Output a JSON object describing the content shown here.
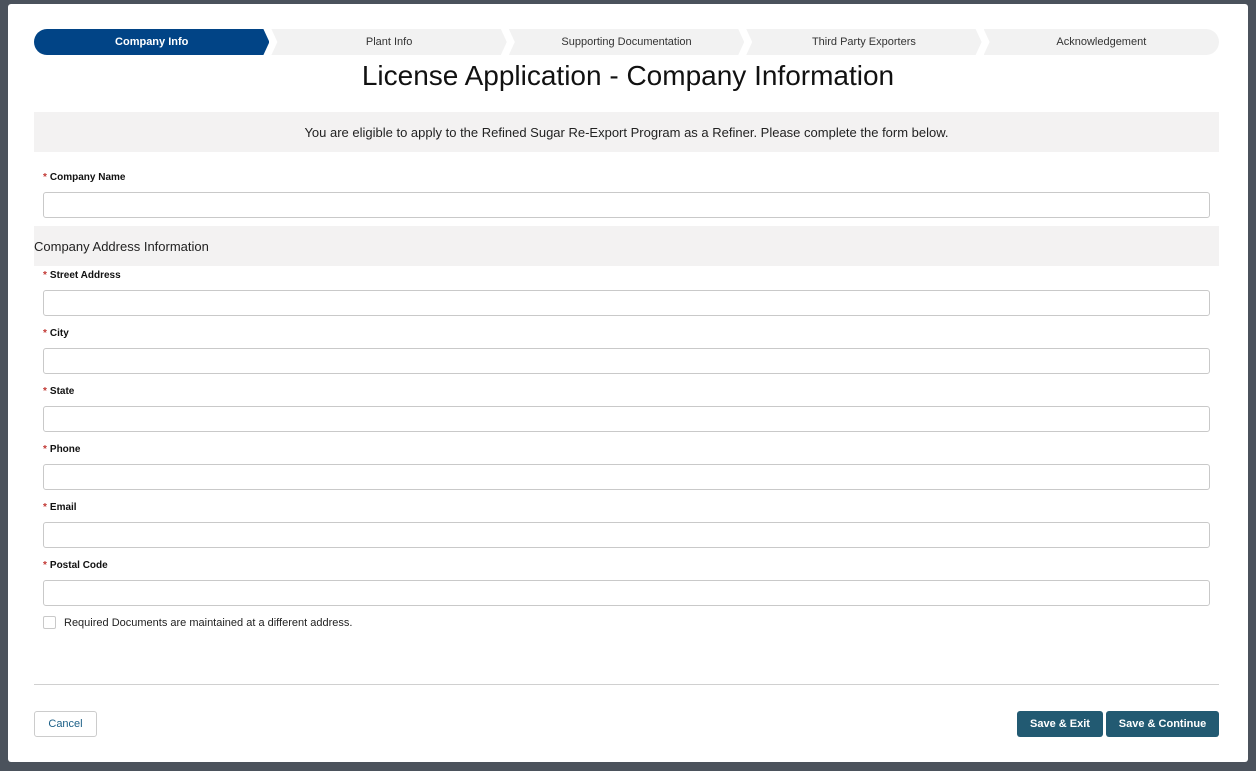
{
  "steps": [
    "Company Info",
    "Plant Info",
    "Supporting Documentation",
    "Third Party Exporters",
    "Acknowledgement"
  ],
  "title": "License Application - Company Information",
  "banner": "You are eligible to apply to the Refined Sugar Re-Export Program as a Refiner. Please complete the form below.",
  "required_marker": "*",
  "company_name_label": "Company Name",
  "section_title": "Company Address Information",
  "fields": [
    "Street Address",
    "City",
    "State",
    "Phone",
    "Email",
    "Postal Code"
  ],
  "checkbox_label": "Required Documents are maintained at a different address.",
  "buttons": {
    "cancel": "Cancel",
    "save_exit": "Save & Exit",
    "save_continue": "Save & Continue"
  }
}
